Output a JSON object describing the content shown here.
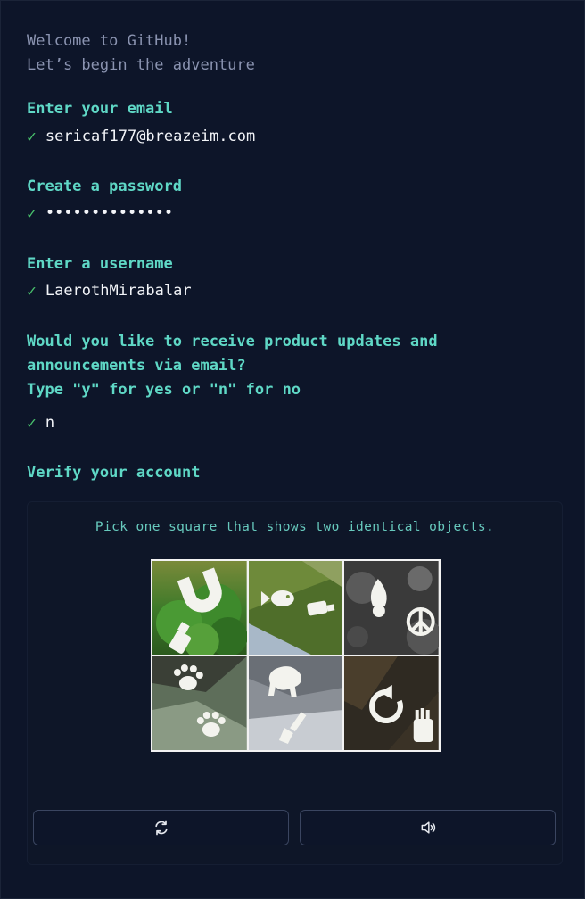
{
  "welcome": {
    "line1": "Welcome to GitHub!",
    "line2": "Let’s begin the adventure"
  },
  "email": {
    "label": "Enter your email",
    "value": "sericaf177@breazeim.com",
    "check": "✓"
  },
  "password": {
    "label": "Create a password",
    "value": "••••••••••••••",
    "check": "✓"
  },
  "username": {
    "label": "Enter a username",
    "value": "LaerothMirabalar",
    "check": "✓"
  },
  "updates": {
    "label_line1": "Would you like to receive product updates and",
    "label_line2": "announcements via email?",
    "label_line3": "Type \"y\" for yes or \"n\" for no",
    "value": "n",
    "check": "✓"
  },
  "verify": {
    "label": "Verify your account",
    "instruction": "Pick one square that shows two identical objects.",
    "tiles": [
      {
        "icons": [
          "u-shape-icon",
          "sprayer-icon"
        ]
      },
      {
        "icons": [
          "fish-icon",
          "bottle-icon"
        ]
      },
      {
        "icons": [
          "acorn-icon",
          "peace-sign-icon"
        ]
      },
      {
        "icons": [
          "paw-print-icon",
          "paw-print-icon"
        ]
      },
      {
        "icons": [
          "elephant-icon",
          "brush-icon"
        ]
      },
      {
        "icons": [
          "refresh-arrow-icon",
          "hand-icon"
        ]
      }
    ],
    "refresh_icon": "refresh-icon",
    "audio_icon": "speaker-icon"
  },
  "colors": {
    "background": "#0d1529",
    "label": "#5fd8c6",
    "muted": "#8a93b0",
    "check": "#48c06c",
    "text": "#f2f4f8"
  }
}
